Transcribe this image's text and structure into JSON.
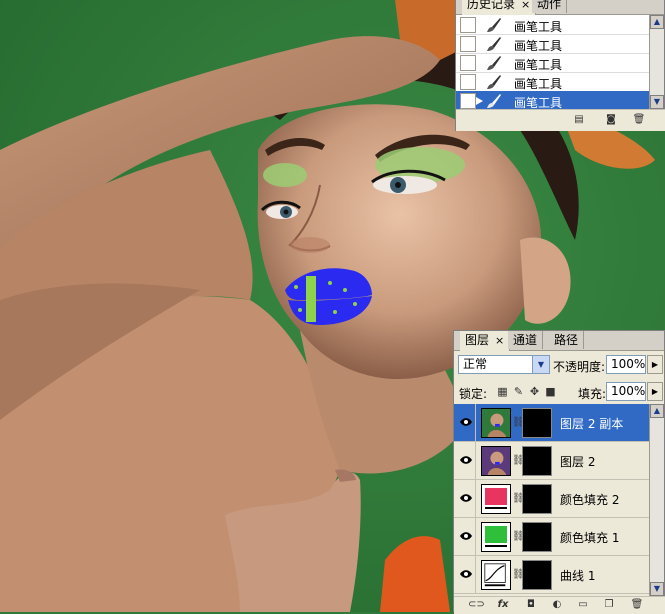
{
  "history": {
    "tabs": [
      {
        "label": "历史记录",
        "close": "×"
      },
      {
        "label": "动作"
      }
    ],
    "items": [
      {
        "label": "画笔工具"
      },
      {
        "label": "画笔工具"
      },
      {
        "label": "画笔工具"
      },
      {
        "label": "画笔工具"
      },
      {
        "label": "画笔工具",
        "selected": true
      }
    ],
    "footer_icons": [
      "new-document-from-state-icon",
      "camera-snapshot-icon",
      "trash-icon"
    ]
  },
  "layers": {
    "tabs": [
      {
        "label": "图层",
        "close": "×"
      },
      {
        "label": "通道"
      },
      {
        "label": "路径"
      }
    ],
    "blend_mode": "正常",
    "opacity_label": "不透明度:",
    "opacity_value": "100%",
    "lock_label": "锁定:",
    "fill_label": "填充:",
    "fill_value": "100%",
    "items": [
      {
        "name": "图层 2 副本",
        "selected": true,
        "kind": "photo"
      },
      {
        "name": "图层 2",
        "kind": "photo"
      },
      {
        "name": "颜色填充 2",
        "kind": "fill",
        "color": "#e8355f"
      },
      {
        "name": "颜色填充 1",
        "kind": "fill",
        "color": "#2fbf3a"
      },
      {
        "name": "曲线 1",
        "kind": "curves"
      }
    ],
    "footer_icons": [
      "link-icon",
      "fx-icon",
      "mask-icon",
      "adjustment-icon",
      "folder-icon",
      "new-layer-icon",
      "trash-icon"
    ]
  },
  "colors": {
    "background": "#2f7a3a",
    "selection": "#316ac5",
    "lips": "#2a2af0",
    "lip_dots": "#8fd34a"
  }
}
